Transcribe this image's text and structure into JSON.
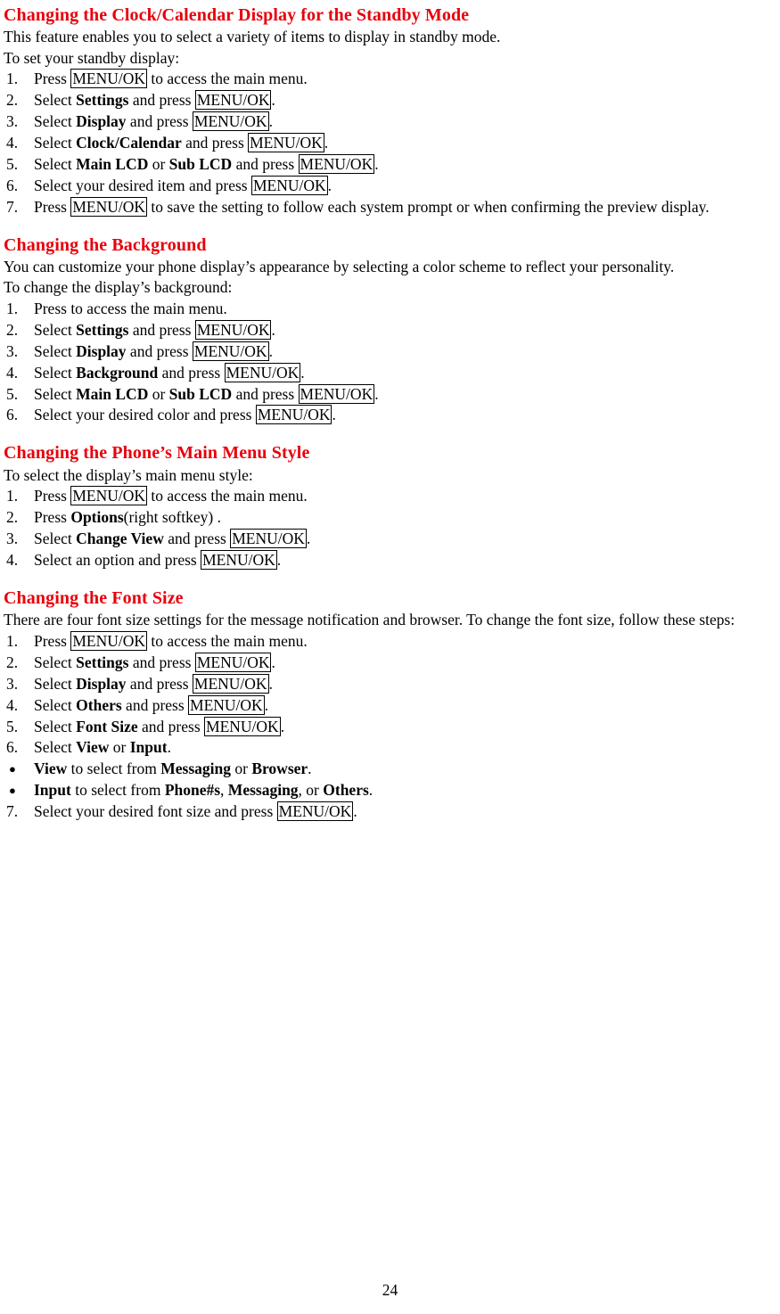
{
  "document": {
    "page_number": "24",
    "sections": [
      {
        "id": "clock_calendar",
        "heading": "Changing the Clock/Calendar Display for the Standby Mode",
        "intro": [
          "This feature enables you to select a variety of items to display in standby mode.",
          "To set your standby display:"
        ],
        "steps": [
          {
            "num": "1.",
            "parts": [
              {
                "t": "Press ",
                "s": "n"
              },
              {
                "t": "MENU/OK",
                "s": "k"
              },
              {
                "t": " to access the main menu.",
                "s": "n"
              }
            ]
          },
          {
            "num": "2.",
            "parts": [
              {
                "t": "Select ",
                "s": "n"
              },
              {
                "t": "Settings",
                "s": "b"
              },
              {
                "t": " and press ",
                "s": "n"
              },
              {
                "t": "MENU/OK",
                "s": "k"
              },
              {
                "t": ".",
                "s": "n"
              }
            ]
          },
          {
            "num": "3.",
            "parts": [
              {
                "t": "Select ",
                "s": "n"
              },
              {
                "t": "Display",
                "s": "b"
              },
              {
                "t": " and press ",
                "s": "n"
              },
              {
                "t": "MENU/OK",
                "s": "k"
              },
              {
                "t": ".",
                "s": "n"
              }
            ]
          },
          {
            "num": "4.",
            "parts": [
              {
                "t": "Select ",
                "s": "n"
              },
              {
                "t": "Clock/Calendar",
                "s": "b"
              },
              {
                "t": " and press ",
                "s": "n"
              },
              {
                "t": "MENU/OK",
                "s": "k"
              },
              {
                "t": ".",
                "s": "n"
              }
            ]
          },
          {
            "num": "5.",
            "parts": [
              {
                "t": "Select ",
                "s": "n"
              },
              {
                "t": "Main LCD",
                "s": "b"
              },
              {
                "t": " or ",
                "s": "n"
              },
              {
                "t": "Sub LCD",
                "s": "b"
              },
              {
                "t": " and press ",
                "s": "n"
              },
              {
                "t": "MENU/OK",
                "s": "k"
              },
              {
                "t": ".",
                "s": "n"
              }
            ]
          },
          {
            "num": "6.",
            "parts": [
              {
                "t": "Select your desired item and press ",
                "s": "n"
              },
              {
                "t": "MENU/OK",
                "s": "k"
              },
              {
                "t": ".",
                "s": "n"
              }
            ]
          },
          {
            "num": "7.",
            "parts": [
              {
                "t": "Press ",
                "s": "n"
              },
              {
                "t": "MENU/OK",
                "s": "k"
              },
              {
                "t": " to save the setting to follow each system prompt or when confirming the preview display.",
                "s": "n"
              }
            ]
          }
        ]
      },
      {
        "id": "background",
        "heading": "Changing the Background",
        "intro": [
          "You can customize your phone display’s appearance by selecting a color scheme to reflect your personality.",
          "To change the display’s background:"
        ],
        "steps": [
          {
            "num": "1.",
            "parts": [
              {
                "t": "Press to access the main menu.",
                "s": "n"
              }
            ]
          },
          {
            "num": "2.",
            "parts": [
              {
                "t": "Select ",
                "s": "n"
              },
              {
                "t": "Settings",
                "s": "b"
              },
              {
                "t": " and press ",
                "s": "n"
              },
              {
                "t": "MENU/OK",
                "s": "k"
              },
              {
                "t": ".",
                "s": "n"
              }
            ]
          },
          {
            "num": "3.",
            "parts": [
              {
                "t": "Select ",
                "s": "n"
              },
              {
                "t": "Display",
                "s": "b"
              },
              {
                "t": " and press ",
                "s": "n"
              },
              {
                "t": "MENU/OK",
                "s": "k"
              },
              {
                "t": ".",
                "s": "n"
              }
            ]
          },
          {
            "num": "4.",
            "parts": [
              {
                "t": "Select ",
                "s": "n"
              },
              {
                "t": "Background",
                "s": "b"
              },
              {
                "t": " and press ",
                "s": "n"
              },
              {
                "t": "MENU/OK",
                "s": "k"
              },
              {
                "t": ".",
                "s": "n"
              }
            ]
          },
          {
            "num": "5.",
            "parts": [
              {
                "t": "Select ",
                "s": "n"
              },
              {
                "t": "Main LCD",
                "s": "b"
              },
              {
                "t": " or ",
                "s": "n"
              },
              {
                "t": "Sub LCD",
                "s": "b"
              },
              {
                "t": " and press ",
                "s": "n"
              },
              {
                "t": "MENU/OK",
                "s": "k"
              },
              {
                "t": ".",
                "s": "n"
              }
            ]
          },
          {
            "num": "6.",
            "parts": [
              {
                "t": "Select your desired color and press ",
                "s": "n"
              },
              {
                "t": "MENU/OK",
                "s": "k"
              },
              {
                "t": ".",
                "s": "n"
              }
            ]
          }
        ]
      },
      {
        "id": "main_menu_style",
        "heading": "Changing the Phone’s Main Menu Style",
        "intro": [
          "To select the display’s main menu style:"
        ],
        "steps": [
          {
            "num": "1.",
            "parts": [
              {
                "t": "Press ",
                "s": "n"
              },
              {
                "t": "MENU/OK",
                "s": "k"
              },
              {
                "t": " to access the main menu.",
                "s": "n"
              }
            ]
          },
          {
            "num": "2.",
            "parts": [
              {
                "t": "Press ",
                "s": "n"
              },
              {
                "t": "Options",
                "s": "b"
              },
              {
                "t": "(right softkey) .",
                "s": "n"
              }
            ]
          },
          {
            "num": "3.",
            "parts": [
              {
                "t": "Select ",
                "s": "n"
              },
              {
                "t": "Change View",
                "s": "b"
              },
              {
                "t": " and press ",
                "s": "n"
              },
              {
                "t": "MENU/OK",
                "s": "k"
              },
              {
                "t": ".",
                "s": "n"
              }
            ]
          },
          {
            "num": "4.",
            "parts": [
              {
                "t": "Select an option and press ",
                "s": "n"
              },
              {
                "t": "MENU/OK",
                "s": "k"
              },
              {
                "t": ".",
                "s": "n"
              }
            ]
          }
        ]
      },
      {
        "id": "font_size",
        "heading": "Changing the Font Size",
        "intro": [
          "There are four font size settings for the message notification and browser. To change the font size, follow these steps:"
        ],
        "steps": [
          {
            "num": "1.",
            "parts": [
              {
                "t": "Press ",
                "s": "n"
              },
              {
                "t": "MENU/OK",
                "s": "k"
              },
              {
                "t": " to access the main menu.",
                "s": "n"
              }
            ]
          },
          {
            "num": "2.",
            "parts": [
              {
                "t": "Select ",
                "s": "n"
              },
              {
                "t": "Settings",
                "s": "b"
              },
              {
                "t": " and press ",
                "s": "n"
              },
              {
                "t": "MENU/OK",
                "s": "k"
              },
              {
                "t": ".",
                "s": "n"
              }
            ]
          },
          {
            "num": "3.",
            "parts": [
              {
                "t": "Select ",
                "s": "n"
              },
              {
                "t": "Display",
                "s": "b"
              },
              {
                "t": " and press ",
                "s": "n"
              },
              {
                "t": "MENU/OK",
                "s": "k"
              },
              {
                "t": ".",
                "s": "n"
              }
            ]
          },
          {
            "num": "4.",
            "parts": [
              {
                "t": "Select ",
                "s": "n"
              },
              {
                "t": "Others",
                "s": "b"
              },
              {
                "t": " and press ",
                "s": "n"
              },
              {
                "t": "MENU/OK",
                "s": "k"
              },
              {
                "t": ".",
                "s": "n"
              }
            ]
          },
          {
            "num": "5.",
            "parts": [
              {
                "t": "Select ",
                "s": "n"
              },
              {
                "t": "Font Size",
                "s": "b"
              },
              {
                "t": " and press ",
                "s": "n"
              },
              {
                "t": "MENU/OK",
                "s": "k"
              },
              {
                "t": ".",
                "s": "n"
              }
            ]
          },
          {
            "num": "6.",
            "parts": [
              {
                "t": "Select ",
                "s": "n"
              },
              {
                "t": "View",
                "s": "b"
              },
              {
                "t": " or ",
                "s": "n"
              },
              {
                "t": "Input",
                "s": "b"
              },
              {
                "t": ".",
                "s": "n"
              }
            ]
          }
        ],
        "bullets": [
          {
            "mark": "●",
            "parts": [
              {
                "t": "View",
                "s": "b"
              },
              {
                "t": " to select from ",
                "s": "n"
              },
              {
                "t": "Messaging",
                "s": "b"
              },
              {
                "t": " or ",
                "s": "n"
              },
              {
                "t": "Browser",
                "s": "b"
              },
              {
                "t": ".",
                "s": "n"
              }
            ]
          },
          {
            "mark": "●",
            "parts": [
              {
                "t": "Input",
                "s": "b"
              },
              {
                "t": " to select from ",
                "s": "n"
              },
              {
                "t": "Phone#s",
                "s": "b"
              },
              {
                "t": ", ",
                "s": "n"
              },
              {
                "t": "Messaging",
                "s": "b"
              },
              {
                "t": ", or ",
                "s": "n"
              },
              {
                "t": "Others",
                "s": "b"
              },
              {
                "t": ".",
                "s": "n"
              }
            ]
          }
        ],
        "steps_after": [
          {
            "num": "7.",
            "parts": [
              {
                "t": "Select your desired font size and press ",
                "s": "n"
              },
              {
                "t": "MENU/OK",
                "s": "k"
              },
              {
                "t": ".",
                "s": "n"
              }
            ]
          }
        ]
      }
    ],
    "colors": {
      "heading": "#e8000b",
      "body": "#000000"
    }
  }
}
